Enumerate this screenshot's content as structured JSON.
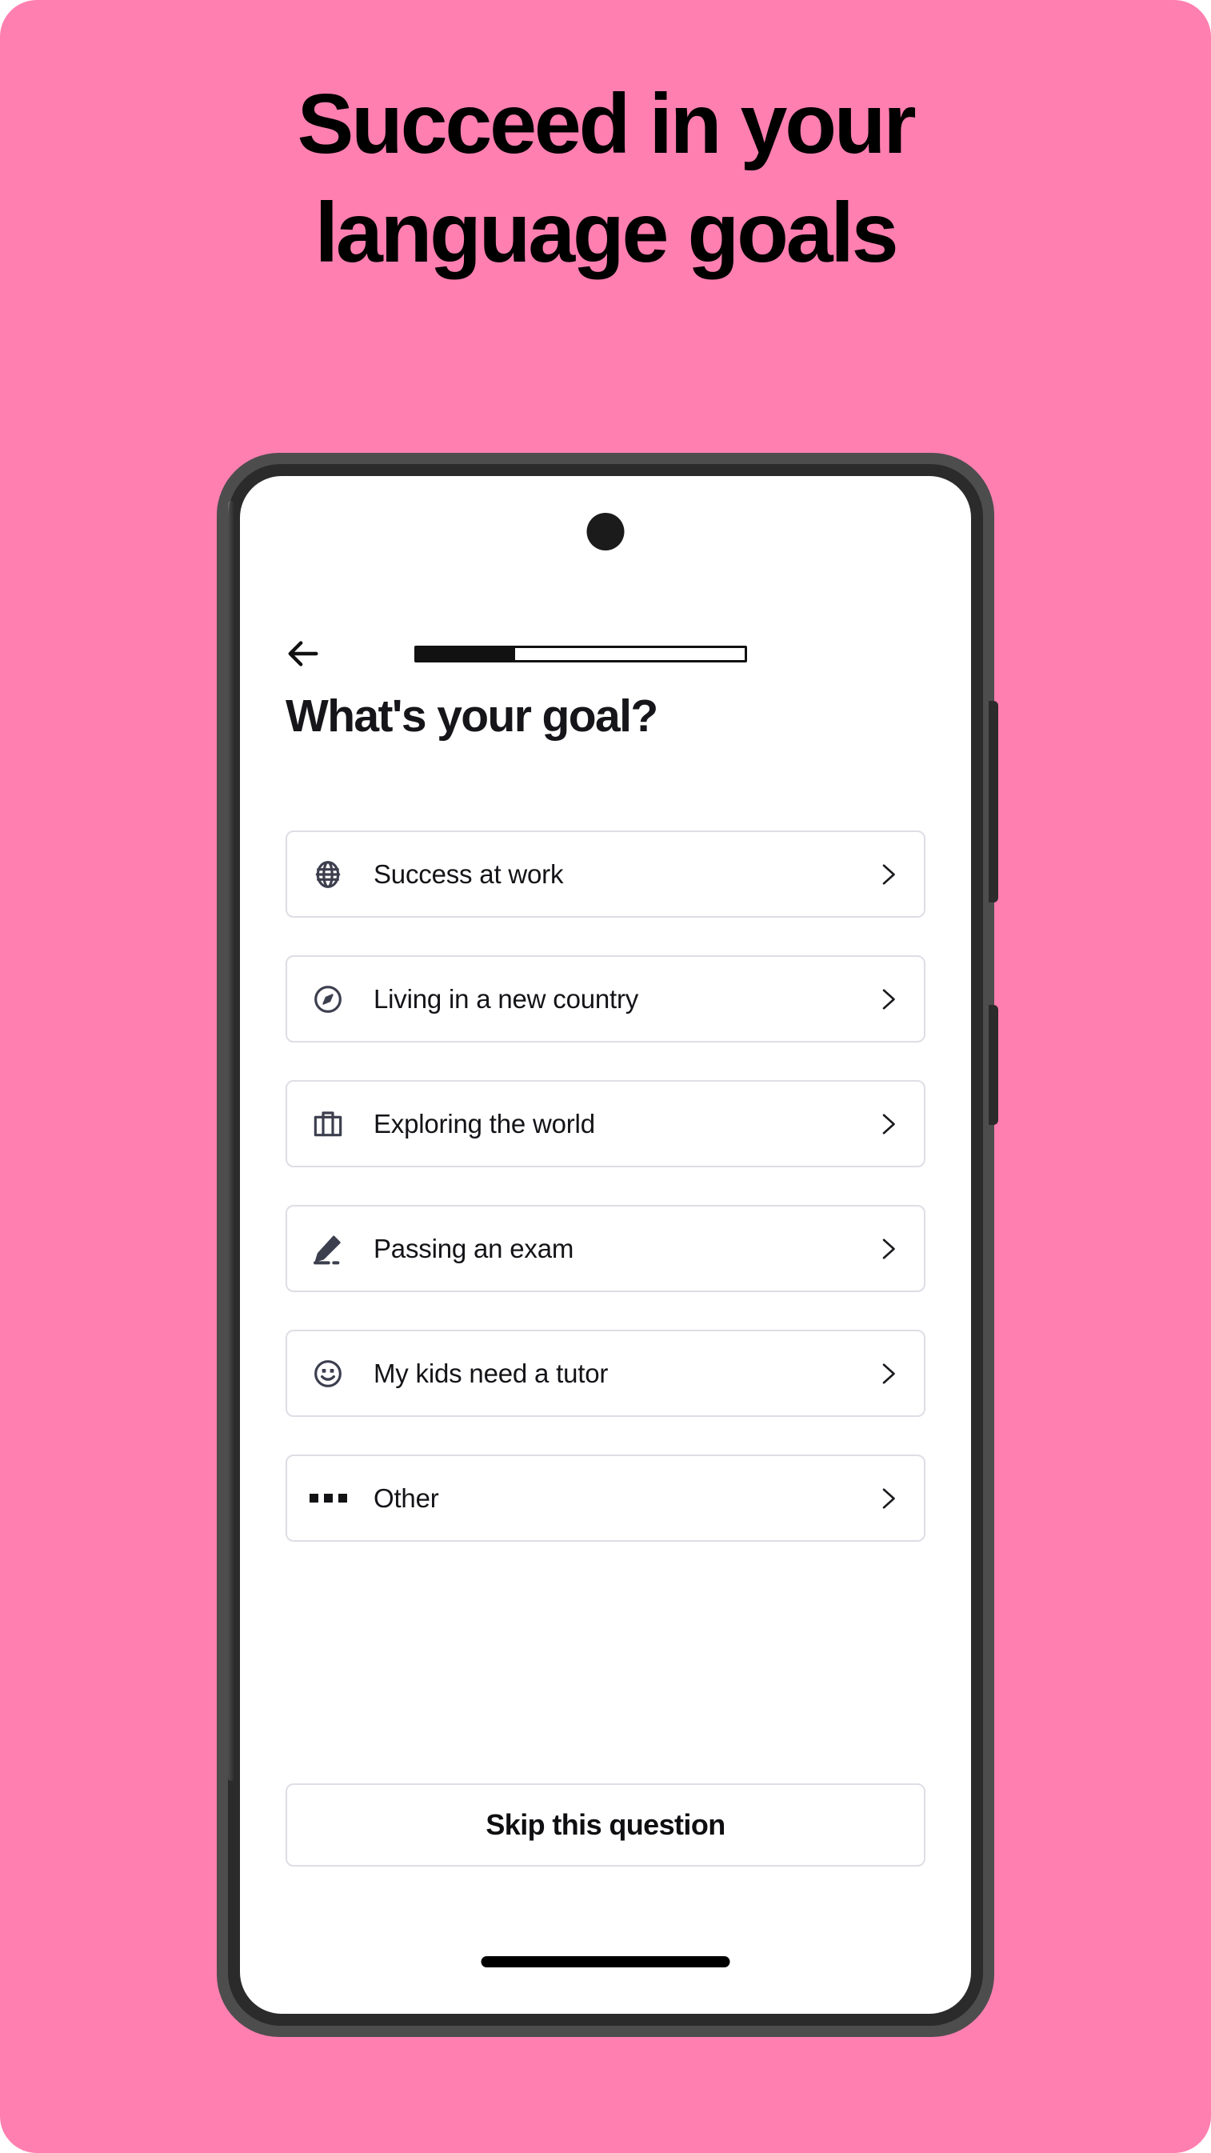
{
  "poster": {
    "background_color": "#ff7fb0",
    "headline_lines": [
      "Succeed in your",
      "language goals"
    ]
  },
  "device": {
    "frame_color": "#4d4d4d",
    "bezel_color": "#2b2b2b",
    "camera_icon": "front-camera-dot",
    "side_buttons": [
      "volume-rocker",
      "power-button"
    ],
    "home_indicator": "gesture-bar"
  },
  "app_screen": {
    "topbar": {
      "back_icon": "arrow-left-icon",
      "progress": {
        "percent": 30,
        "fill_color": "#111111",
        "track_color": "#ffffff",
        "border_color": "#111111"
      }
    },
    "title": "What's your goal?",
    "options": [
      {
        "icon": "globe-icon",
        "label": "Success at work",
        "chevron": "chevron-right-icon"
      },
      {
        "icon": "compass-icon",
        "label": "Living in a new country",
        "chevron": "chevron-right-icon"
      },
      {
        "icon": "briefcase-icon",
        "label": "Exploring the world",
        "chevron": "chevron-right-icon"
      },
      {
        "icon": "pencil-icon",
        "label": "Passing an exam",
        "chevron": "chevron-right-icon"
      },
      {
        "icon": "smiley-icon",
        "label": "My kids need a tutor",
        "chevron": "chevron-right-icon"
      },
      {
        "icon": "ellipsis-icon",
        "label": "Other",
        "chevron": "chevron-right-icon"
      }
    ],
    "skip_button_label": "Skip this question",
    "colors": {
      "card_border": "#dedee6",
      "icon": "#3c3f4e",
      "text": "#141418"
    }
  }
}
